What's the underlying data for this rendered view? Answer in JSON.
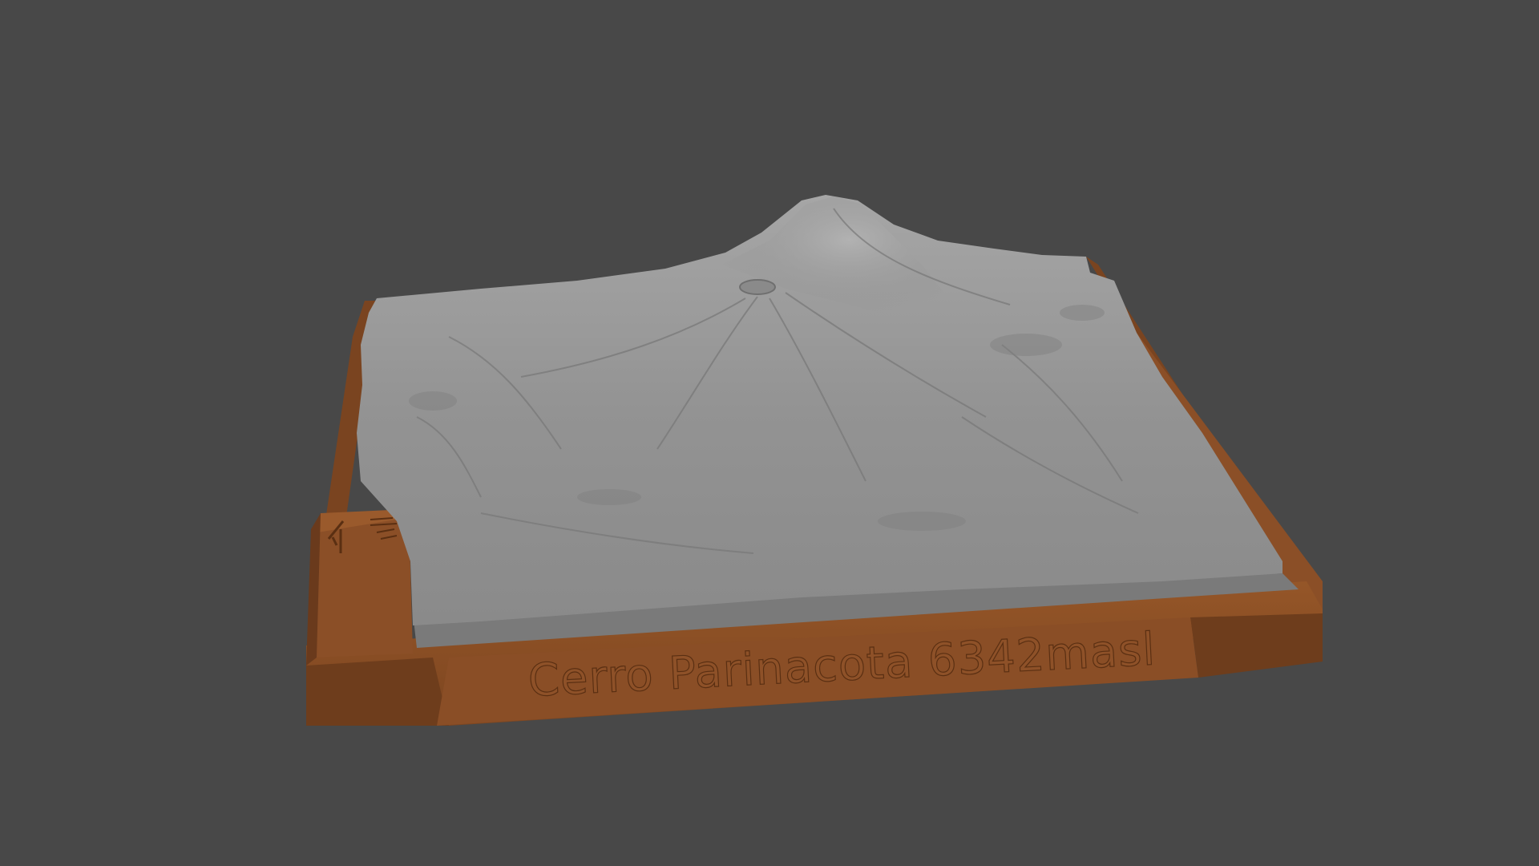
{
  "viewport": {
    "background_color": "#484848"
  },
  "model": {
    "plaque_text": "Cerro Parinacota 6342masl",
    "base_color": "#8b4f27",
    "base_shadow_color": "#6a3a1c",
    "terrain_color": "#8c8c8c",
    "terrain_highlight_color": "#a8a8a8"
  },
  "legend_block": {
    "icon": "north-arrow-icon"
  }
}
